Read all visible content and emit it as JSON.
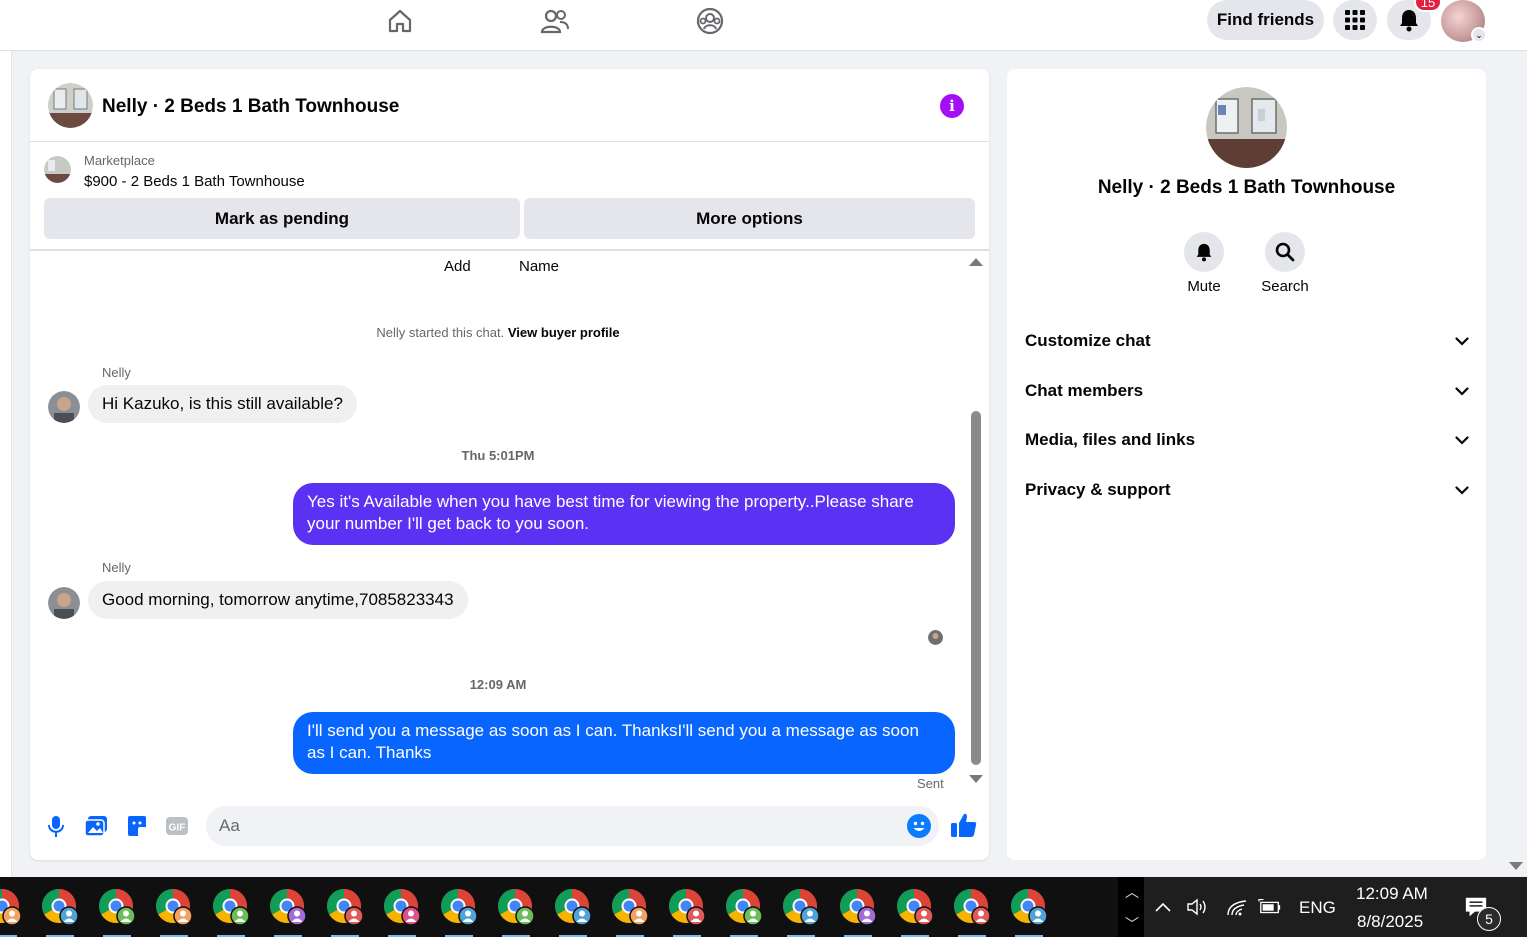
{
  "topbar": {
    "nav_icons": [
      "home-icon",
      "friends-icon",
      "groups-icon"
    ],
    "find_friends_label": "Find friends",
    "notification_count": "15"
  },
  "chat": {
    "title": "Nelly · 2 Beds 1 Bath Townhouse",
    "marketplace": {
      "label": "Marketplace",
      "listing": "$900 - 2 Beds 1 Bath Townhouse"
    },
    "actions": {
      "mark_pending": "Mark as pending",
      "more_options": "More options"
    },
    "quick_labels": {
      "add": "Add",
      "name": "Name"
    },
    "started_text": "Nelly started this chat.",
    "view_buyer_profile": "View buyer profile",
    "messages": [
      {
        "sender": "Nelly",
        "text": "Hi Kazuko, is this still available?"
      },
      {
        "timestamp": "Thu 5:01PM"
      },
      {
        "text": "Yes it's Available when you have best time for viewing the property..Please share your number I'll get back to you soon."
      },
      {
        "sender": "Nelly",
        "text": "Good morning, tomorrow anytime,7085823343"
      },
      {
        "timestamp": "12:09 AM"
      },
      {
        "text": "I'll send you a message as soon as I can. ThanksI'll send you a message as soon as I can. Thanks"
      }
    ],
    "sent_label": "Sent",
    "composer_placeholder": "Aa",
    "colors": {
      "outgoing_1": "#5b31f4",
      "outgoing_2": "#0866ff",
      "accent": "#0a7cff"
    }
  },
  "info_panel": {
    "name": "Nelly · 2 Beds 1 Bath Townhouse",
    "mute_label": "Mute",
    "search_label": "Search",
    "sections": [
      "Customize chat",
      "Chat members",
      "Media, files and links",
      "Privacy & support"
    ]
  },
  "taskbar": {
    "language": "ENG",
    "time": "12:09 AM",
    "date": "8/8/2025",
    "notification_count": "5",
    "app_count": 19,
    "app_icon": "chrome-icon"
  }
}
